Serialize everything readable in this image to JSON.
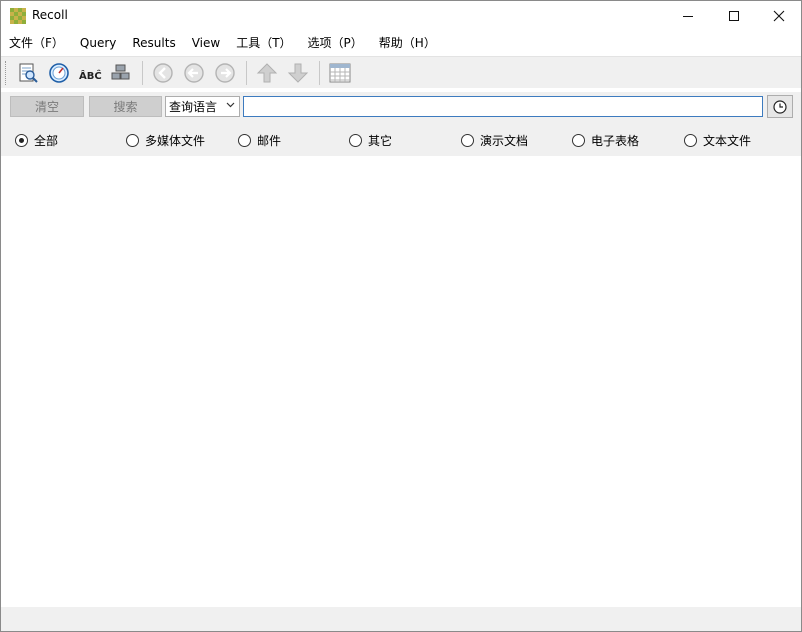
{
  "window": {
    "title": "Recoll",
    "minimize_icon": "minimize-icon",
    "maximize_icon": "maximize-icon",
    "close_icon": "close-icon"
  },
  "menu": {
    "items": [
      "文件（F）",
      "Query",
      "Results",
      "View",
      "工具（T）",
      "选项（P）",
      "帮助（H）"
    ]
  },
  "toolbar": {
    "icons": [
      "document-preview-icon",
      "spell-dial-icon",
      "accent-abc-icon",
      "stack-blocks-icon",
      "first-page-icon",
      "previous-page-icon",
      "next-page-icon",
      "sort-up-arrow-icon",
      "sort-down-arrow-icon",
      "table-view-icon"
    ]
  },
  "search": {
    "clear_label": "清空",
    "search_label": "搜索",
    "query_mode": "查询语言",
    "query_value": "",
    "history_icon": "clock-icon"
  },
  "categories": {
    "selected": "全部",
    "items": [
      "全部",
      "多媒体文件",
      "邮件",
      "其它",
      "演示文档",
      "电子表格",
      "文本文件"
    ]
  },
  "colors": {
    "input_border": "#3d7bbf",
    "panel_bg": "#f0f0f0"
  }
}
